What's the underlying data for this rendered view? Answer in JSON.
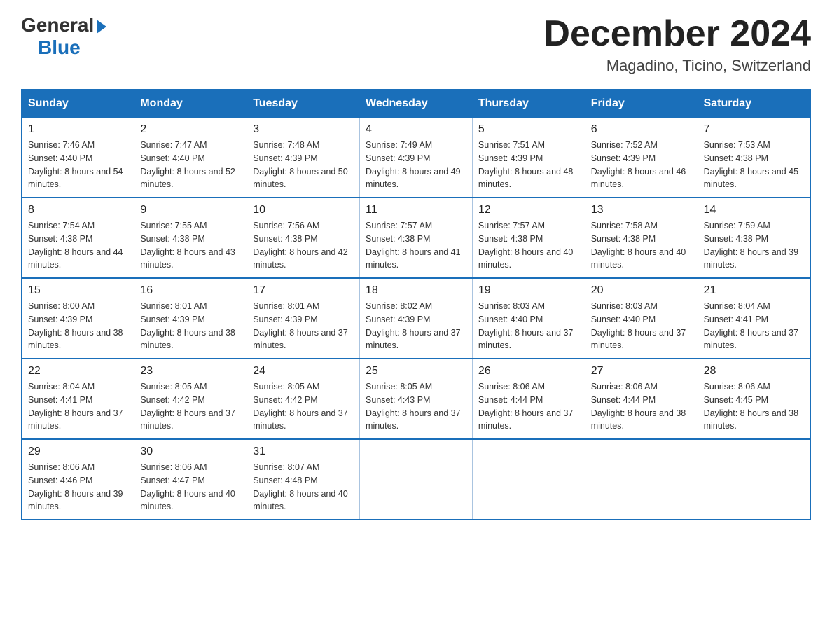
{
  "header": {
    "logo_general": "General",
    "logo_blue": "Blue",
    "month_title": "December 2024",
    "location": "Magadino, Ticino, Switzerland"
  },
  "calendar": {
    "days_of_week": [
      "Sunday",
      "Monday",
      "Tuesday",
      "Wednesday",
      "Thursday",
      "Friday",
      "Saturday"
    ],
    "weeks": [
      [
        {
          "day": "1",
          "sunrise": "7:46 AM",
          "sunset": "4:40 PM",
          "daylight": "8 hours and 54 minutes."
        },
        {
          "day": "2",
          "sunrise": "7:47 AM",
          "sunset": "4:40 PM",
          "daylight": "8 hours and 52 minutes."
        },
        {
          "day": "3",
          "sunrise": "7:48 AM",
          "sunset": "4:39 PM",
          "daylight": "8 hours and 50 minutes."
        },
        {
          "day": "4",
          "sunrise": "7:49 AM",
          "sunset": "4:39 PM",
          "daylight": "8 hours and 49 minutes."
        },
        {
          "day": "5",
          "sunrise": "7:51 AM",
          "sunset": "4:39 PM",
          "daylight": "8 hours and 48 minutes."
        },
        {
          "day": "6",
          "sunrise": "7:52 AM",
          "sunset": "4:39 PM",
          "daylight": "8 hours and 46 minutes."
        },
        {
          "day": "7",
          "sunrise": "7:53 AM",
          "sunset": "4:38 PM",
          "daylight": "8 hours and 45 minutes."
        }
      ],
      [
        {
          "day": "8",
          "sunrise": "7:54 AM",
          "sunset": "4:38 PM",
          "daylight": "8 hours and 44 minutes."
        },
        {
          "day": "9",
          "sunrise": "7:55 AM",
          "sunset": "4:38 PM",
          "daylight": "8 hours and 43 minutes."
        },
        {
          "day": "10",
          "sunrise": "7:56 AM",
          "sunset": "4:38 PM",
          "daylight": "8 hours and 42 minutes."
        },
        {
          "day": "11",
          "sunrise": "7:57 AM",
          "sunset": "4:38 PM",
          "daylight": "8 hours and 41 minutes."
        },
        {
          "day": "12",
          "sunrise": "7:57 AM",
          "sunset": "4:38 PM",
          "daylight": "8 hours and 40 minutes."
        },
        {
          "day": "13",
          "sunrise": "7:58 AM",
          "sunset": "4:38 PM",
          "daylight": "8 hours and 40 minutes."
        },
        {
          "day": "14",
          "sunrise": "7:59 AM",
          "sunset": "4:38 PM",
          "daylight": "8 hours and 39 minutes."
        }
      ],
      [
        {
          "day": "15",
          "sunrise": "8:00 AM",
          "sunset": "4:39 PM",
          "daylight": "8 hours and 38 minutes."
        },
        {
          "day": "16",
          "sunrise": "8:01 AM",
          "sunset": "4:39 PM",
          "daylight": "8 hours and 38 minutes."
        },
        {
          "day": "17",
          "sunrise": "8:01 AM",
          "sunset": "4:39 PM",
          "daylight": "8 hours and 37 minutes."
        },
        {
          "day": "18",
          "sunrise": "8:02 AM",
          "sunset": "4:39 PM",
          "daylight": "8 hours and 37 minutes."
        },
        {
          "day": "19",
          "sunrise": "8:03 AM",
          "sunset": "4:40 PM",
          "daylight": "8 hours and 37 minutes."
        },
        {
          "day": "20",
          "sunrise": "8:03 AM",
          "sunset": "4:40 PM",
          "daylight": "8 hours and 37 minutes."
        },
        {
          "day": "21",
          "sunrise": "8:04 AM",
          "sunset": "4:41 PM",
          "daylight": "8 hours and 37 minutes."
        }
      ],
      [
        {
          "day": "22",
          "sunrise": "8:04 AM",
          "sunset": "4:41 PM",
          "daylight": "8 hours and 37 minutes."
        },
        {
          "day": "23",
          "sunrise": "8:05 AM",
          "sunset": "4:42 PM",
          "daylight": "8 hours and 37 minutes."
        },
        {
          "day": "24",
          "sunrise": "8:05 AM",
          "sunset": "4:42 PM",
          "daylight": "8 hours and 37 minutes."
        },
        {
          "day": "25",
          "sunrise": "8:05 AM",
          "sunset": "4:43 PM",
          "daylight": "8 hours and 37 minutes."
        },
        {
          "day": "26",
          "sunrise": "8:06 AM",
          "sunset": "4:44 PM",
          "daylight": "8 hours and 37 minutes."
        },
        {
          "day": "27",
          "sunrise": "8:06 AM",
          "sunset": "4:44 PM",
          "daylight": "8 hours and 38 minutes."
        },
        {
          "day": "28",
          "sunrise": "8:06 AM",
          "sunset": "4:45 PM",
          "daylight": "8 hours and 38 minutes."
        }
      ],
      [
        {
          "day": "29",
          "sunrise": "8:06 AM",
          "sunset": "4:46 PM",
          "daylight": "8 hours and 39 minutes."
        },
        {
          "day": "30",
          "sunrise": "8:06 AM",
          "sunset": "4:47 PM",
          "daylight": "8 hours and 40 minutes."
        },
        {
          "day": "31",
          "sunrise": "8:07 AM",
          "sunset": "4:48 PM",
          "daylight": "8 hours and 40 minutes."
        },
        null,
        null,
        null,
        null
      ]
    ]
  }
}
